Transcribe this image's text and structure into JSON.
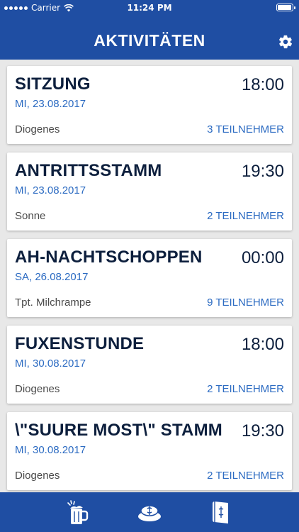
{
  "status_bar": {
    "carrier": "Carrier",
    "time": "11:24 PM",
    "battery_level": 0.95
  },
  "header": {
    "title": "AKTIVITÄTEN",
    "settings_icon": "gear-icon"
  },
  "activities": [
    {
      "name": "SITZUNG",
      "time": "18:00",
      "date": "MI, 23.08.2017",
      "location": "Diogenes",
      "participants": "3 TEILNEHMER"
    },
    {
      "name": "ANTRITTSSTAMM",
      "time": "19:30",
      "date": "MI, 23.08.2017",
      "location": "Sonne",
      "participants": "2 TEILNEHMER"
    },
    {
      "name": "AH-NACHTSCHOPPEN",
      "time": "00:00",
      "date": "SA, 26.08.2017",
      "location": "Tpt. Milchrampe",
      "participants": "9 TEILNEHMER"
    },
    {
      "name": "FUXENSTUNDE",
      "time": "18:00",
      "date": "MI, 30.08.2017",
      "location": "Diogenes",
      "participants": "2 TEILNEHMER"
    },
    {
      "name": "\\\"SUURE MOST\\\" STAMM",
      "time": "19:30",
      "date": "MI, 30.08.2017",
      "location": "Diogenes",
      "participants": "2 TEILNEHMER"
    }
  ],
  "tabbar": {
    "tabs": [
      {
        "icon": "beer-mug-icon"
      },
      {
        "icon": "student-cap-icon"
      },
      {
        "icon": "book-icon"
      }
    ]
  },
  "colors": {
    "brand": "#1f4ea3",
    "accent": "#2c6bc2",
    "title_text": "#0d1f3d"
  }
}
